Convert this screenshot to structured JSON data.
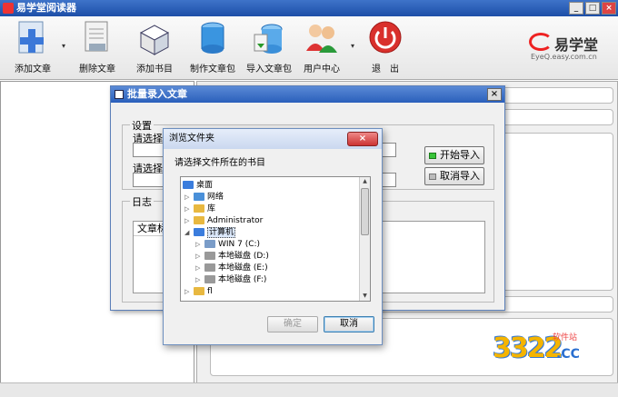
{
  "app": {
    "title": "易学堂阅读器",
    "window_buttons": [
      "_",
      "□",
      "×"
    ]
  },
  "toolbar": {
    "items": [
      {
        "label": "添加文章",
        "icon": "add-article-icon",
        "has_dropdown": true
      },
      {
        "label": "删除文章",
        "icon": "delete-article-icon",
        "has_dropdown": false
      },
      {
        "label": "添加书目",
        "icon": "add-book-icon",
        "has_dropdown": false
      },
      {
        "label": "制作文章包",
        "icon": "make-package-icon",
        "has_dropdown": false
      },
      {
        "label": "导入文章包",
        "icon": "import-package-icon",
        "has_dropdown": false
      },
      {
        "label": "用户中心",
        "icon": "user-center-icon",
        "has_dropdown": true
      },
      {
        "label": "退　出",
        "icon": "power-icon",
        "has_dropdown": false
      }
    ],
    "dropdown_glyph": "▾"
  },
  "logo": {
    "brand": "易学堂",
    "sub": "EyeQ.easy.com.cn",
    "accent": "#e22222"
  },
  "batch_dialog": {
    "title": "批量录入文章",
    "close": "×",
    "settings_group": "设置",
    "select_label_1": "请选择",
    "select_label_2": "请选择",
    "start_button": "开始导入",
    "cancel_button": "取消导入",
    "log_group": "日志",
    "log_column": "文章标"
  },
  "browse_dialog": {
    "title": "浏览文件夹",
    "close": "×",
    "description": "请选择文件所在的书目",
    "tree": [
      {
        "label": "桌面",
        "level": 0,
        "toggle": "",
        "icon": "desktop-icon",
        "color": "#3b7ddd"
      },
      {
        "label": "网络",
        "level": 1,
        "toggle": "▷",
        "icon": "network-icon",
        "color": "#4a90d9"
      },
      {
        "label": "库",
        "level": 1,
        "toggle": "▷",
        "icon": "library-icon",
        "color": "#e8b840"
      },
      {
        "label": "Administrator",
        "level": 1,
        "toggle": "▷",
        "icon": "user-folder-icon",
        "color": "#e8b840"
      },
      {
        "label": "计算机",
        "level": 1,
        "toggle": "◢",
        "icon": "computer-icon",
        "color": "#3b7ddd",
        "selected": true
      },
      {
        "label": "WIN 7 (C:)",
        "level": 2,
        "toggle": "▷",
        "icon": "system-drive-icon",
        "color": "#7a9cc8"
      },
      {
        "label": "本地磁盘 (D:)",
        "level": 2,
        "toggle": "▷",
        "icon": "drive-icon",
        "color": "#999999"
      },
      {
        "label": "本地磁盘 (E:)",
        "level": 2,
        "toggle": "▷",
        "icon": "drive-icon",
        "color": "#999999"
      },
      {
        "label": "本地磁盘 (F:)",
        "level": 2,
        "toggle": "▷",
        "icon": "drive-icon",
        "color": "#999999"
      },
      {
        "label": "fl",
        "level": 1,
        "toggle": "▷",
        "icon": "folder-icon",
        "color": "#e8b840"
      }
    ],
    "ok_button": "确定",
    "cancel_button": "取消"
  },
  "watermark": {
    "number": "3322",
    "suffix": ".CC",
    "tag": "软件站"
  }
}
